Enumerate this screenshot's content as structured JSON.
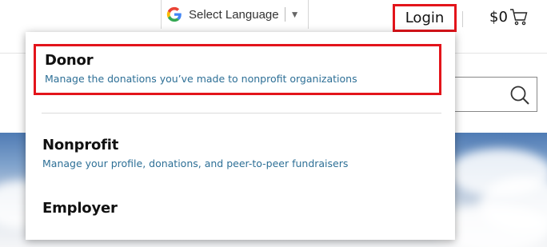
{
  "header": {
    "language_selector": {
      "label": "Select Language",
      "icon": "google-g-icon",
      "arrow": "▼"
    },
    "login_label": "Login",
    "cart_amount": "$0",
    "cart_icon": "shopping-cart-icon"
  },
  "search": {
    "icon": "search-icon"
  },
  "login_menu": {
    "items": [
      {
        "title": "Donor",
        "description": "Manage the donations you’ve made to nonprofit organizations"
      },
      {
        "title": "Nonprofit",
        "description": "Manage your profile, donations, and peer-to-peer fundraisers"
      },
      {
        "title": "Employer",
        "description": ""
      }
    ]
  },
  "colors": {
    "highlight_border": "#e3141b",
    "description_text": "#2d6f96",
    "hero_sky": "#4f7bb4"
  }
}
